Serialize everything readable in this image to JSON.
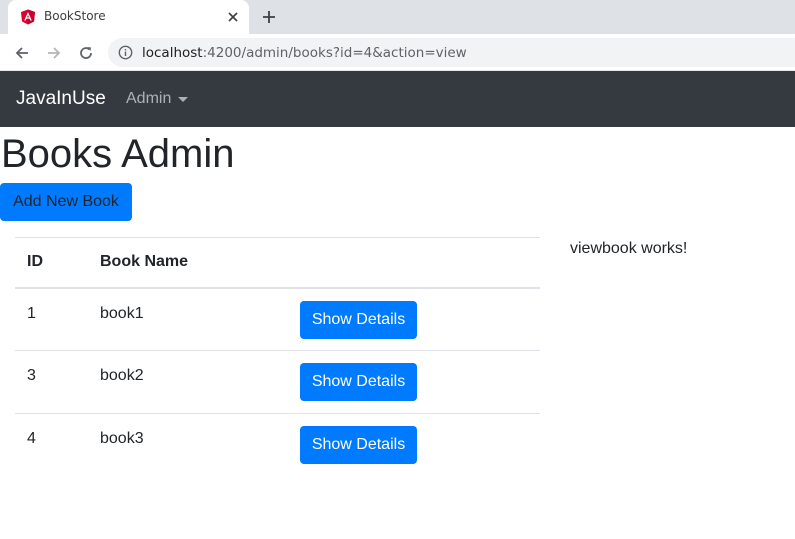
{
  "browser": {
    "tab_title": "BookStore",
    "url_host": "localhost",
    "url_rest": ":4200/admin/books?id=4&action=view",
    "icons": {
      "favicon": "angular-icon",
      "close": "close-icon",
      "new_tab": "plus-icon",
      "back": "arrow-left-icon",
      "forward": "arrow-right-icon",
      "reload": "reload-icon",
      "info": "info-icon"
    }
  },
  "navbar": {
    "brand": "JavaInUse",
    "admin_label": "Admin",
    "bg_color": "#343a40"
  },
  "page": {
    "title": "Books Admin",
    "add_button": "Add New Book",
    "accent_color": "#007bff"
  },
  "table": {
    "headers": {
      "id": "ID",
      "name": "Book Name"
    },
    "rows": [
      {
        "id": "1",
        "name": "book1",
        "action": "Show Details"
      },
      {
        "id": "3",
        "name": "book2",
        "action": "Show Details"
      },
      {
        "id": "4",
        "name": "book3",
        "action": "Show Details"
      }
    ]
  },
  "viewbook": {
    "message": "viewbook works!"
  }
}
